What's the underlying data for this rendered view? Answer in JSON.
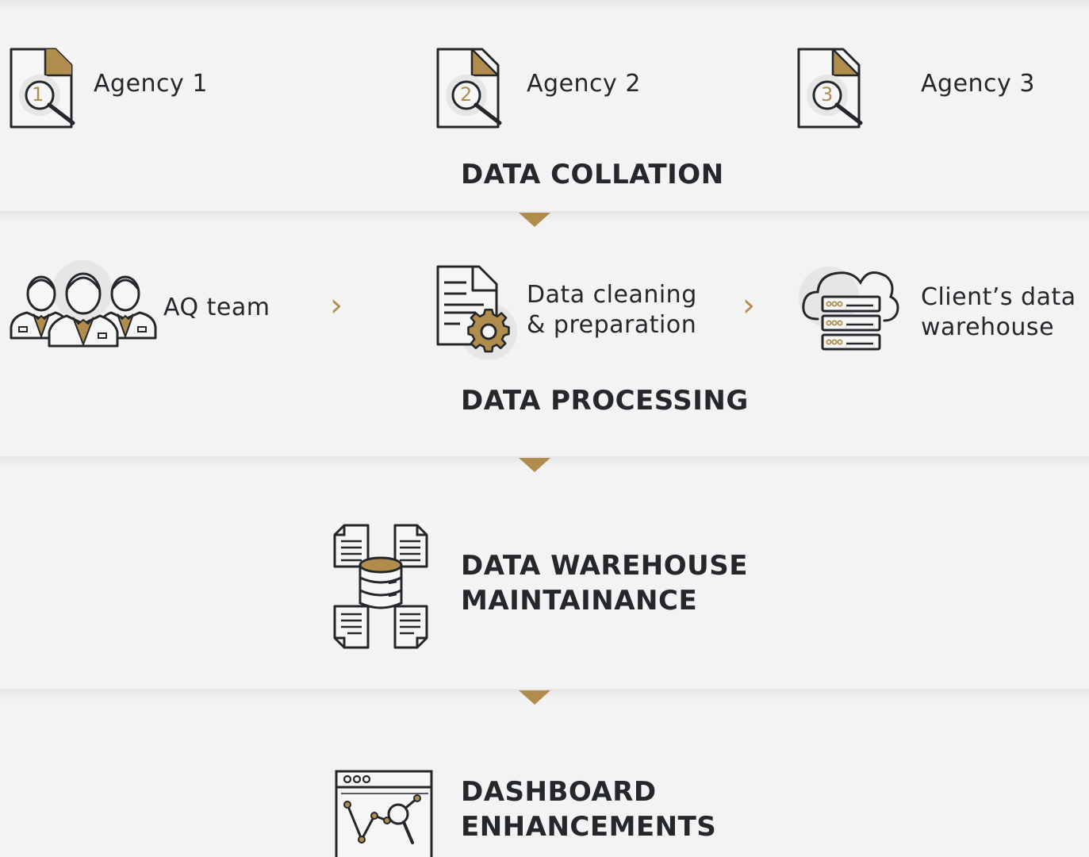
{
  "colors": {
    "accent": "#b08d4c",
    "ink": "#24272b",
    "background": "#f3f3f3"
  },
  "collation": {
    "agencies": [
      {
        "number": "1",
        "label": "Agency 1"
      },
      {
        "number": "2",
        "label": "Agency 2"
      },
      {
        "number": "3",
        "label": "Agency 3"
      }
    ],
    "heading": "DATA COLLATION"
  },
  "processing": {
    "steps": [
      {
        "label": "AQ team",
        "icon": "team-icon"
      },
      {
        "label_line1": "Data cleaning",
        "label_line2": "& preparation",
        "icon": "document-gear-icon"
      },
      {
        "label_line1": "Client’s data",
        "label_line2": "warehouse",
        "icon": "cloud-server-icon"
      }
    ],
    "arrow_glyph": "›",
    "heading": "DATA PROCESSING"
  },
  "warehouse": {
    "heading_line1": "DATA WAREHOUSE",
    "heading_line2": "MAINTAINANCE",
    "icon": "database-documents-icon"
  },
  "dashboard": {
    "heading_line1": "DASHBOARD",
    "heading_line2": "ENHANCEMENTS",
    "icon": "dashboard-chart-icon"
  }
}
